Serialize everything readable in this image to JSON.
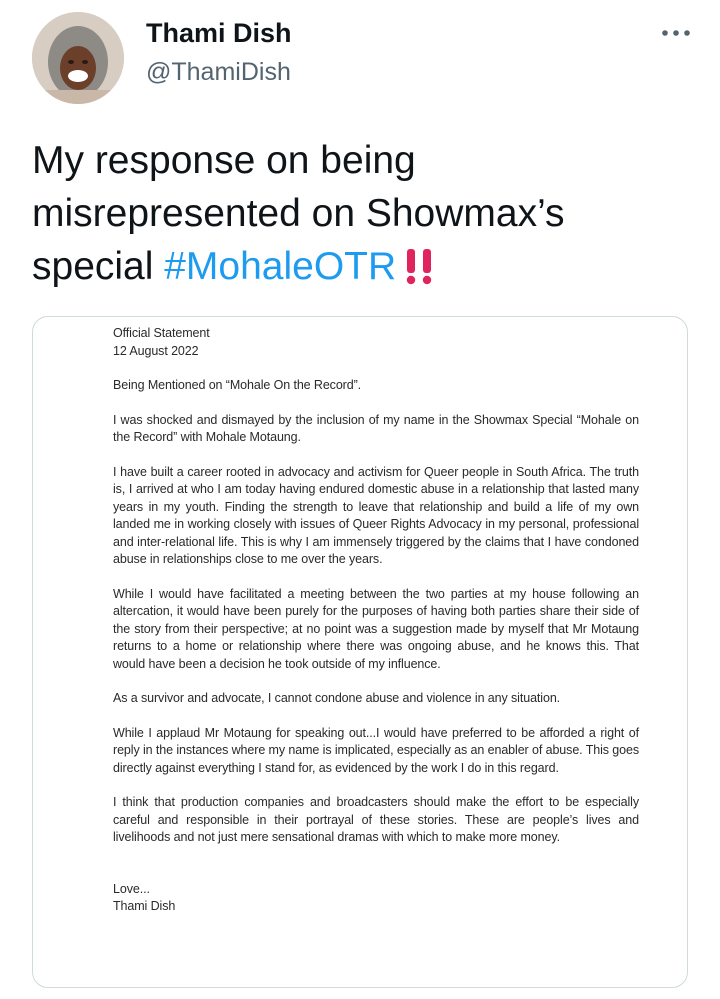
{
  "tweet": {
    "author": {
      "name": "Thami Dish",
      "handle": "@ThamiDish"
    },
    "text_before_hashtag": "My response on being misrepresented on Showmax’s special ",
    "hashtag": "#MohaleOTR",
    "more_icon": "more-horizontal-icon",
    "alert_icon": "double-exclamation-icon",
    "colors": {
      "hashtag": "#1d9bf0",
      "alert": "#e0245e",
      "handle": "#536471"
    }
  },
  "document": {
    "heading": "Official Statement",
    "date": "12 August 2022",
    "subject": "Being Mentioned on “Mohale On the Record”.",
    "paragraphs": [
      "I was shocked and dismayed by the inclusion of my name in the Showmax Special “Mohale on the Record” with Mohale Motaung.",
      "I have built a career rooted in advocacy and activism for Queer people in South Africa. The truth is, I arrived at who I am today having endured domestic abuse in a relationship that lasted many years in my youth. Finding the strength to leave that relationship and build a life of my own landed me in working closely with issues of Queer Rights Advocacy in my personal, professional and inter-relational life. This is why I am immensely triggered by the claims that I have condoned abuse in relationships close to me over the years.",
      "While I would have facilitated a meeting between the two parties at my house following an altercation, it would have been purely for the purposes of having both parties share their side of the story from their perspective; at no point was a suggestion made by myself that Mr Motaung returns to a home or relationship where there was ongoing abuse, and he knows this. That would have been a decision he took outside of my influence.",
      "As a survivor and advocate, I cannot condone abuse and violence in any situation.",
      "While I applaud Mr Motaung for speaking out...I would have preferred to be afforded a right of reply in the instances where my name is implicated, especially as an enabler of abuse. This goes directly against everything I stand for, as evidenced by the work I do in this regard.",
      "I think that production companies and broadcasters should make the effort to be especially careful and responsible in their portrayal of these stories. These are people’s lives and livelihoods and not just mere sensational dramas with which to make more money."
    ],
    "closing": "Love...",
    "signature": "Thami Dish"
  }
}
